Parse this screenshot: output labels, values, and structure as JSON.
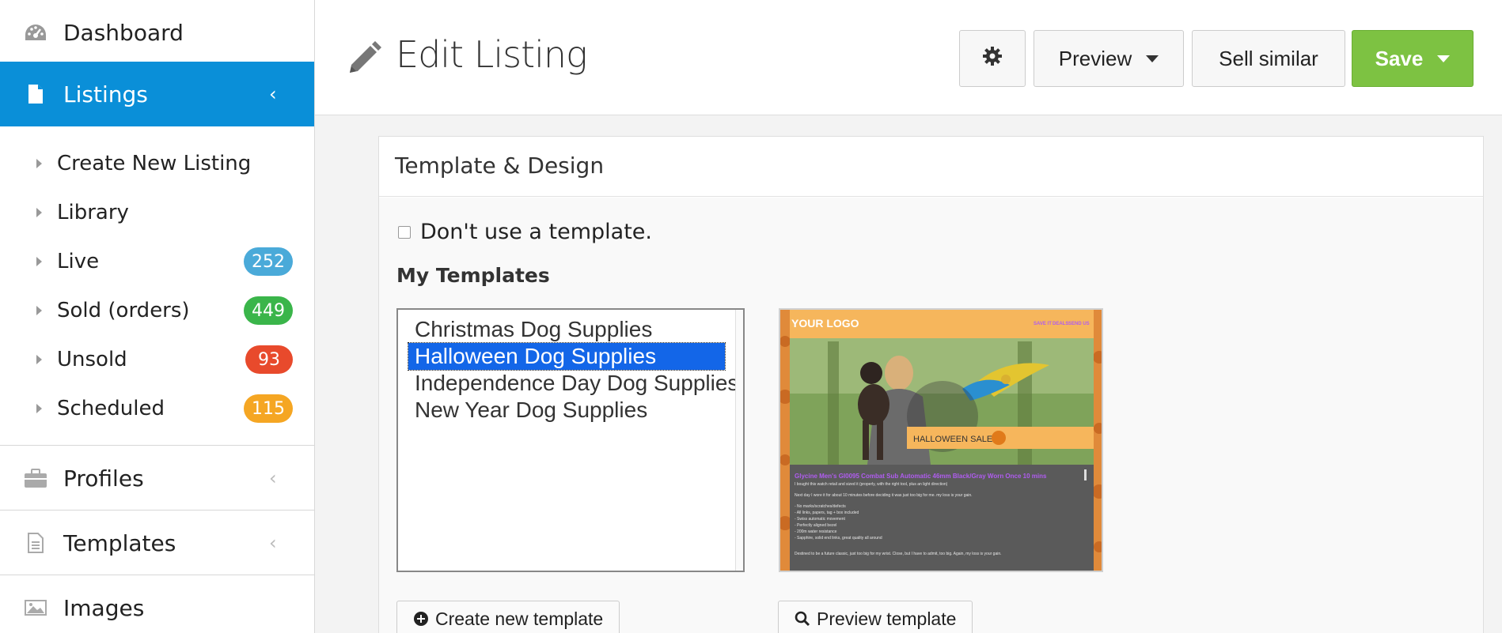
{
  "sidebar": {
    "dashboard": "Dashboard",
    "listings": "Listings",
    "sub_items": [
      {
        "label": "Create New Listing"
      },
      {
        "label": "Library"
      },
      {
        "label": "Live",
        "badge": "252",
        "badge_color": "#4aaad9"
      },
      {
        "label": "Sold (orders)",
        "badge": "449",
        "badge_color": "#3ab54a"
      },
      {
        "label": "Unsold",
        "badge": "93",
        "badge_color": "#e84a2c"
      },
      {
        "label": "Scheduled",
        "badge": "115",
        "badge_color": "#f5a623"
      }
    ],
    "profiles": "Profiles",
    "templates": "Templates",
    "images": "Images"
  },
  "header": {
    "title": "Edit Listing",
    "preview_label": "Preview",
    "sell_similar_label": "Sell similar",
    "save_label": "Save"
  },
  "panel": {
    "title": "Template & Design",
    "no_template_label": "Don't use a template.",
    "no_template_checked": false,
    "my_templates_label": "My Templates",
    "templates": [
      "Christmas Dog Supplies",
      "Halloween Dog Supplies",
      "Independence Day Dog Supplies",
      "New Year Dog Supplies"
    ],
    "selected_template": "Halloween Dog Supplies",
    "create_template_label": "Create new template",
    "preview_template_label": "Preview template"
  },
  "preview": {
    "logo": "YOUR LOGO",
    "nav": [
      "SAVE IT",
      "DEALS",
      "SEND US"
    ],
    "banner": "HALLOWEEN SALE!",
    "item_title": "Glycine Men's GI0095 Combat Sub Automatic 46mm Black/Gray Worn Once 10 mins",
    "lines": [
      "I bought this watch retail and sized it (properly, with the right tool, plus an light direction)",
      "Next day I wore it for about 10 minutes before deciding it was just too big for me. my loss is your gain.",
      "- No marks/scratches/defects",
      "- All links, papers, tag + box included",
      "- Swiss automatic movement",
      "- Perfectly aligned bezel",
      "- 200m water resistance",
      "- Sapphire, solid end links, great quality all around",
      "Destined to be a future classic, just too big for my wrist. Close, but I have to admit, too big. Again, my loss is your gain."
    ]
  },
  "colors": {
    "accent_blue": "#0a8fd8",
    "save_green": "#7dc242",
    "preview_header": "#f6b65c",
    "preview_title": "#b05cf0"
  }
}
